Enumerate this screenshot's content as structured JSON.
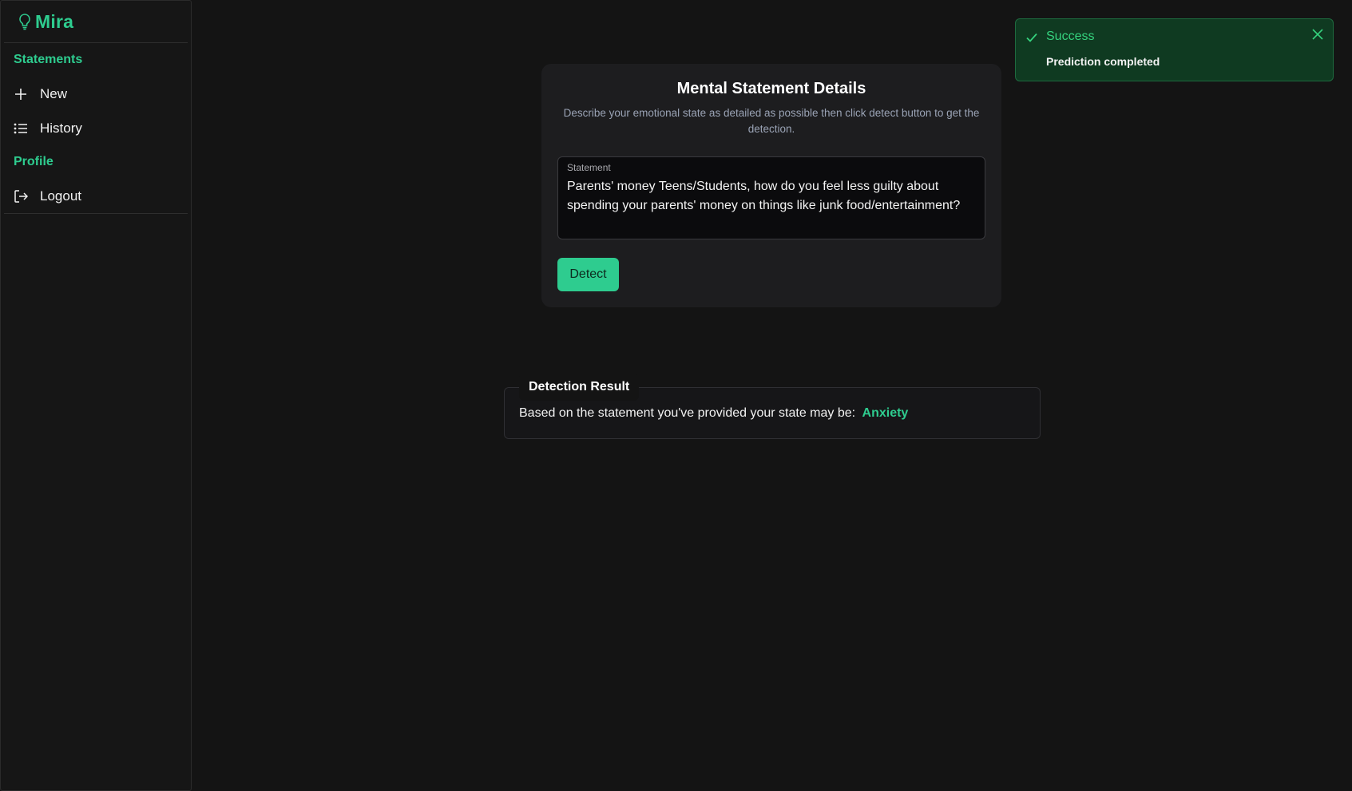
{
  "app": {
    "name": "Mira",
    "logo_icon": "lightbulb-icon",
    "accent_color": "#2ecc8f"
  },
  "sidebar": {
    "sections": [
      {
        "title": "Statements",
        "items": [
          {
            "label": "New",
            "icon": "plus-icon"
          },
          {
            "label": "History",
            "icon": "list-icon"
          }
        ]
      },
      {
        "title": "Profile",
        "items": [
          {
            "label": "Logout",
            "icon": "logout-icon"
          }
        ]
      }
    ]
  },
  "form": {
    "title": "Mental Statement Details",
    "subtitle": "Describe your emotional state as detailed as possible then click detect button to get the detection.",
    "statement_label": "Statement",
    "statement_value": "Parents' money Teens/Students, how do you feel less guilty about spending your parents' money on things like junk food/entertainment?",
    "detect_label": "Detect"
  },
  "result": {
    "title": "Detection Result",
    "text": "Based on the statement you've provided your state may be:",
    "value": "Anxiety"
  },
  "toast": {
    "title": "Success",
    "message": "Prediction completed",
    "color": "#35d27e"
  }
}
